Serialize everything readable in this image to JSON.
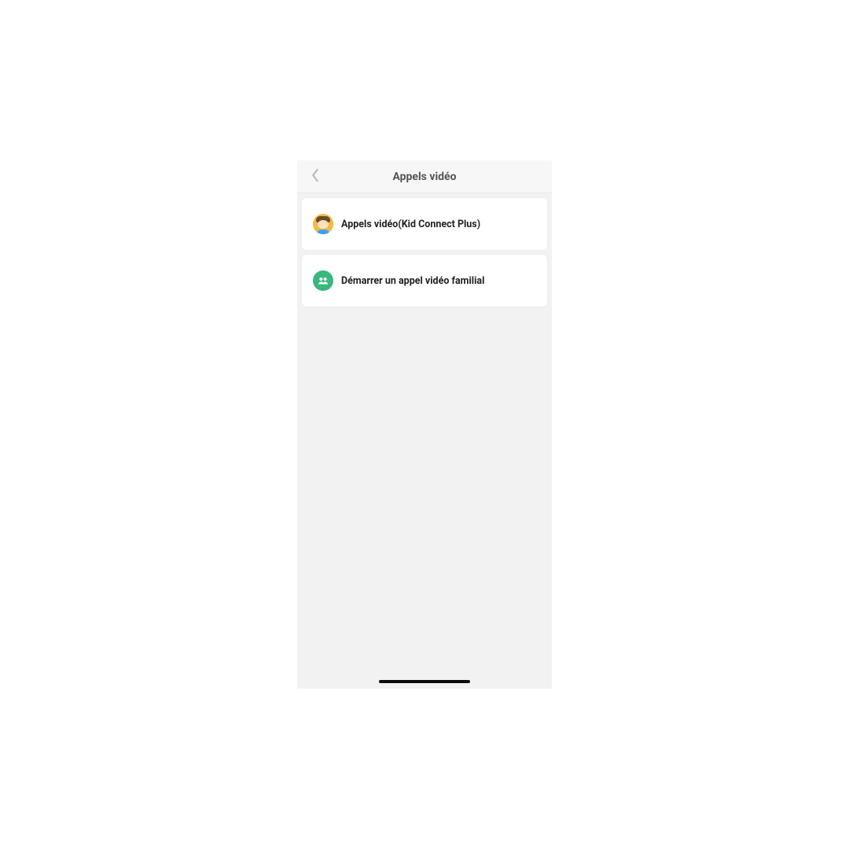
{
  "header": {
    "title": "Appels vidéo"
  },
  "list": {
    "items": [
      {
        "label": "Appels vidéo(Kid Connect Plus)",
        "icon": "kid-avatar-icon"
      },
      {
        "label": "Démarrer un appel vidéo familial",
        "icon": "group-icon"
      }
    ]
  }
}
